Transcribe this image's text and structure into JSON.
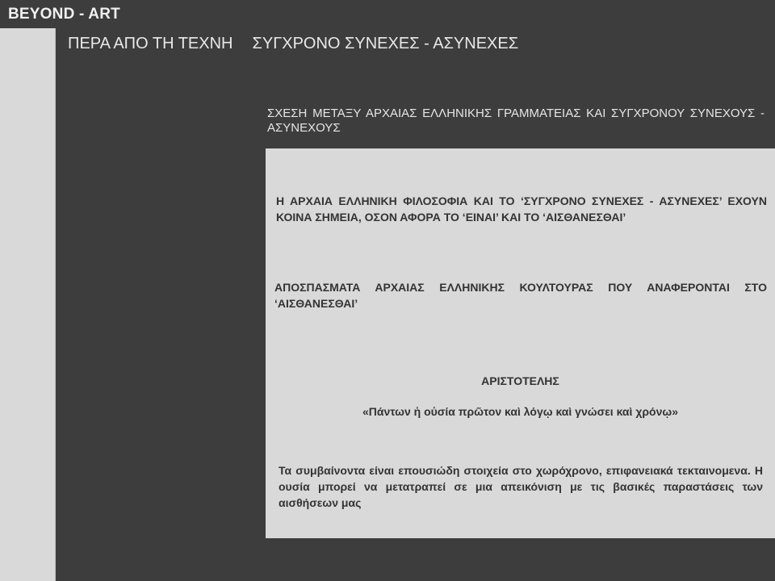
{
  "site": {
    "title": "BEYOND - ART"
  },
  "nav": {
    "items": [
      {
        "label": "ΠΕΡΑ ΑΠΟ ΤΗ ΤΕΧΝΗ"
      },
      {
        "label": "ΣΥΓΧΡΟΝΟ ΣΥΝΕΧΕΣ - ΑΣΥΝΕΧΕΣ"
      }
    ]
  },
  "main": {
    "heading": "ΣΧΕΣΗ ΜΕΤΑΞΥ ΑΡΧΑΙΑΣ ΕΛΛΗΝΙΚΗΣ ΓΡΑΜΜΑΤΕΙΑΣ ΚΑΙ ΣΥΓΧΡΟΝΟΥ ΣΥΝΕΧΟΥΣ - ΑΣΥΝΕΧΟΥΣ",
    "box": {
      "paragraph_1": "Η ΑΡΧΑΙΑ ΕΛΛΗΝΙΚΗ ΦΙΛΟΣΟΦΙΑ ΚΑΙ ΤΟ ‘ΣΥΓΧΡΟΝΟ ΣΥΝΕΧΕΣ - ΑΣΥΝΕΧΕΣ’ ΕΧΟΥΝ ΚΟΙΝΑ ΣΗΜΕΙΑ, ΟΣΟΝ ΑΦΟΡΑ ΤΟ ‘ΕΙΝΑΙ’ ΚΑΙ ΤΟ ‘ΑΙΣΘΑΝΕΣΘΑΙ’",
      "paragraph_2": "ΑΠΟΣΠΑΣΜΑΤΑ ΑΡΧΑΙΑΣ ΕΛΛΗΝΙΚΗΣ ΚΟΥΛΤΟΥΡΑΣ ΠΟΥ ΑΝΑΦΕΡΟΝΤΑΙ ΣΤΟ ‘ΑΙΣΘΑΝΕΣΘΑΙ’",
      "author": "ΑΡΙΣΤΟΤΕΛΗΣ",
      "quote": "«Πάντων ἡ οὐσία πρῶτον καὶ λόγῳ καὶ γνώσει καὶ χρόνῳ»",
      "paragraph_3": "Τα συμβαίνοντα είναι επουσιώδη στοιχεία στο χωρόχρονο, επιφανειακά τεκταινομενα. Η ουσία μπορεί να μετατραπεί σε μια απεικόνιση με τις βασικές παραστάσεις των αισθήσεων μας"
    }
  },
  "colors": {
    "background": "#3d3d3d",
    "panel": "#d9d9d9",
    "panel_text": "#333333",
    "light_text": "#e6e6e6"
  }
}
